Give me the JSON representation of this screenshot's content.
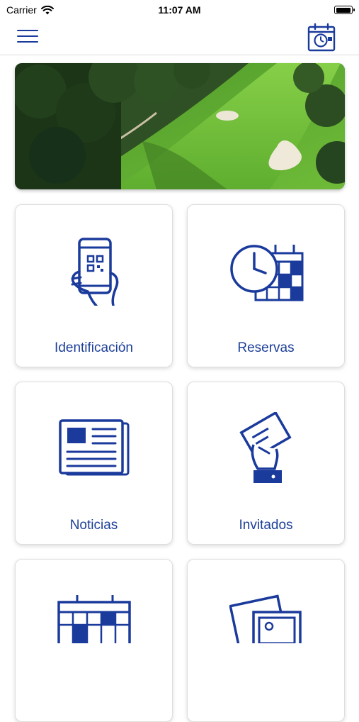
{
  "status_bar": {
    "carrier": "Carrier",
    "time": "11:07 AM",
    "battery_level": 1.0
  },
  "nav_bar": {
    "menu_icon": "hamburger-menu-icon",
    "calendar_icon": "calendar-clock-icon"
  },
  "colors": {
    "brand_blue": "#1a3a9c",
    "label_blue": "#1d3f99"
  },
  "hero": {
    "image": "golf-course-aerial-photo"
  },
  "tiles": [
    {
      "label": "Identificación",
      "icon": "phone-qr-code-icon"
    },
    {
      "label": "Reservas",
      "icon": "clock-calendar-icon"
    },
    {
      "label": "Noticias",
      "icon": "newspaper-icon"
    },
    {
      "label": "Invitados",
      "icon": "hand-ticket-icon"
    },
    {
      "label": "",
      "icon": "calendar-icon"
    },
    {
      "label": "",
      "icon": "photo-gallery-icon"
    }
  ]
}
